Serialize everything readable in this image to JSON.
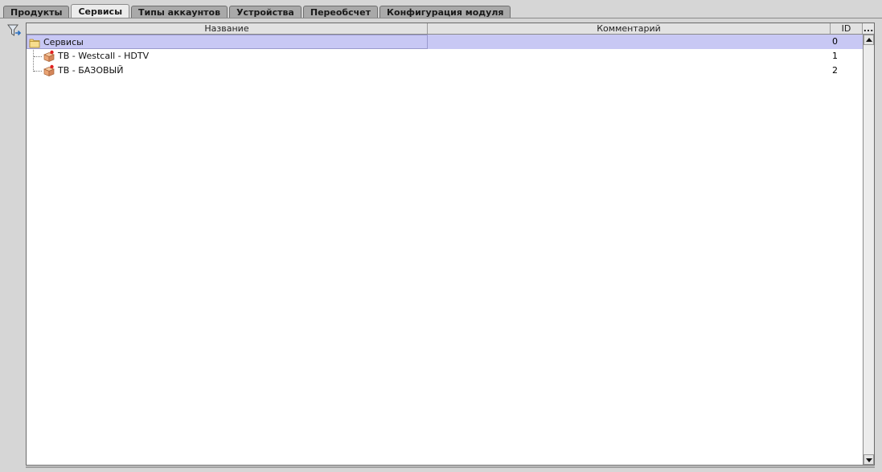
{
  "tabs": [
    {
      "label": "Продукты",
      "active": false
    },
    {
      "label": "Сервисы",
      "active": true
    },
    {
      "label": "Типы аккаунтов",
      "active": false
    },
    {
      "label": "Устройства",
      "active": false
    },
    {
      "label": "Переобсчет",
      "active": false
    },
    {
      "label": "Конфигурация модуля",
      "active": false
    }
  ],
  "toolbar": {
    "filter_icon": "filter-icon"
  },
  "grid": {
    "columns": {
      "name": "Название",
      "comment": "Комментарий",
      "id": "ID",
      "more": "..."
    },
    "rows": [
      {
        "name": "Сервисы",
        "comment": "",
        "id": "0",
        "icon": "folder-icon",
        "level": 0,
        "selected": true
      },
      {
        "name": "ТВ - Westcall - HDTV",
        "comment": "",
        "id": "1",
        "icon": "service-box-icon",
        "level": 1,
        "selected": false
      },
      {
        "name": "ТВ - БАЗОВЫЙ",
        "comment": "",
        "id": "2",
        "icon": "service-box-icon",
        "level": 1,
        "selected": false
      }
    ]
  },
  "colors": {
    "selection": "#c8c8f4",
    "tab_inactive": "#a9a9a9",
    "tab_active": "#ececec"
  }
}
